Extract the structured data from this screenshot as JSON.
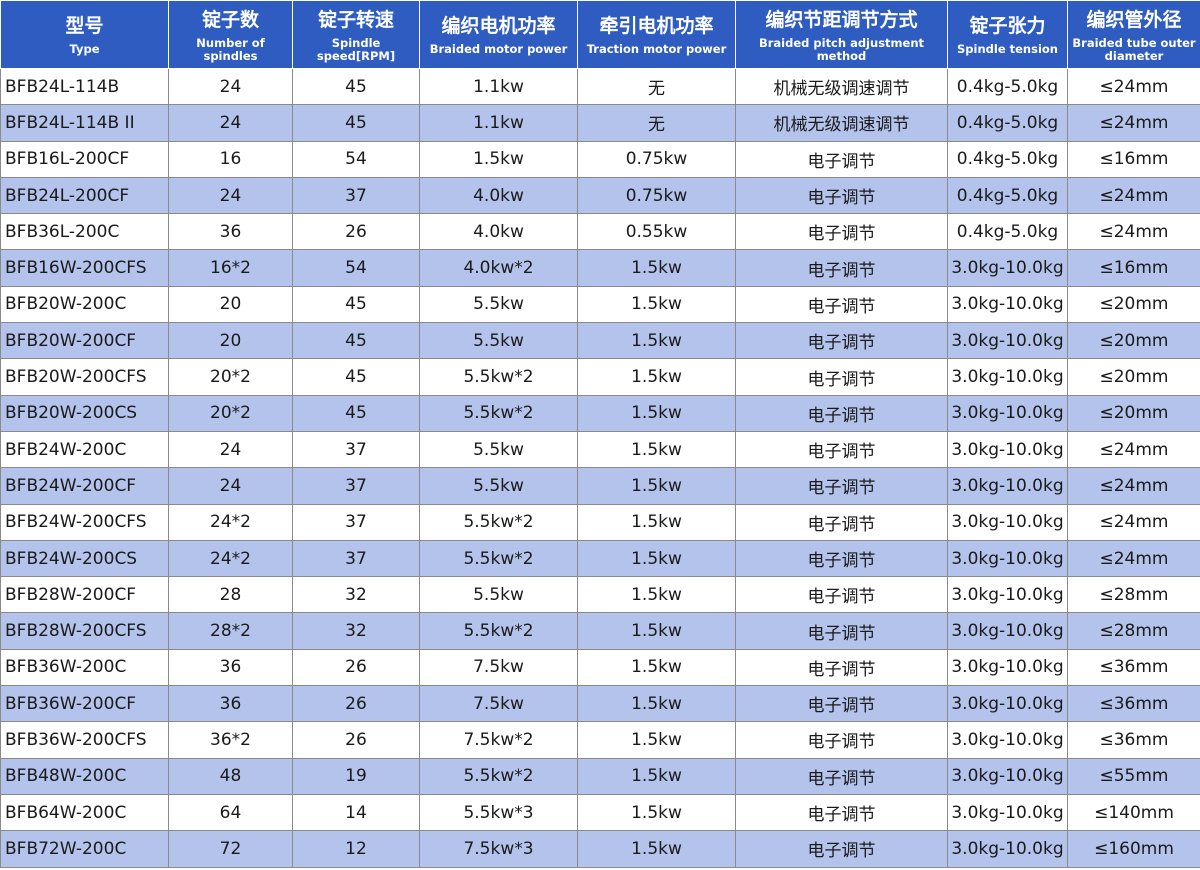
{
  "table": {
    "headers": [
      {
        "zh": "型号",
        "en": "Type"
      },
      {
        "zh": "锭子数",
        "en": "Number of spindles"
      },
      {
        "zh": "锭子转速",
        "en": "Spindle speed[RPM]"
      },
      {
        "zh": "编织电机功率",
        "en": "Braided motor power"
      },
      {
        "zh": "牵引电机功率",
        "en": "Traction motor power"
      },
      {
        "zh": "编织节距调节方式",
        "en": "Braided pitch adjustment method"
      },
      {
        "zh": "锭子张力",
        "en": "Spindle tension"
      },
      {
        "zh": "编织管外径",
        "en": "Braided tube outer diameter"
      }
    ],
    "rows": [
      [
        "BFB24L-114B",
        "24",
        "45",
        "1.1kw",
        "无",
        "机械无级调速调节",
        "0.4kg-5.0kg",
        "≤24mm"
      ],
      [
        "BFB24L-114B II",
        "24",
        "45",
        "1.1kw",
        "无",
        "机械无级调速调节",
        "0.4kg-5.0kg",
        "≤24mm"
      ],
      [
        "BFB16L-200CF",
        "16",
        "54",
        "1.5kw",
        "0.75kw",
        "电子调节",
        "0.4kg-5.0kg",
        "≤16mm"
      ],
      [
        "BFB24L-200CF",
        "24",
        "37",
        "4.0kw",
        "0.75kw",
        "电子调节",
        "0.4kg-5.0kg",
        "≤24mm"
      ],
      [
        "BFB36L-200C",
        "36",
        "26",
        "4.0kw",
        "0.55kw",
        "电子调节",
        "0.4kg-5.0kg",
        "≤24mm"
      ],
      [
        "BFB16W-200CFS",
        "16*2",
        "54",
        "4.0kw*2",
        "1.5kw",
        "电子调节",
        "3.0kg-10.0kg",
        "≤16mm"
      ],
      [
        "BFB20W-200C",
        "20",
        "45",
        "5.5kw",
        "1.5kw",
        "电子调节",
        "3.0kg-10.0kg",
        "≤20mm"
      ],
      [
        "BFB20W-200CF",
        "20",
        "45",
        "5.5kw",
        "1.5kw",
        "电子调节",
        "3.0kg-10.0kg",
        "≤20mm"
      ],
      [
        "BFB20W-200CFS",
        "20*2",
        "45",
        "5.5kw*2",
        "1.5kw",
        "电子调节",
        "3.0kg-10.0kg",
        "≤20mm"
      ],
      [
        "BFB20W-200CS",
        "20*2",
        "45",
        "5.5kw*2",
        "1.5kw",
        "电子调节",
        "3.0kg-10.0kg",
        "≤20mm"
      ],
      [
        "BFB24W-200C",
        "24",
        "37",
        "5.5kw",
        "1.5kw",
        "电子调节",
        "3.0kg-10.0kg",
        "≤24mm"
      ],
      [
        "BFB24W-200CF",
        "24",
        "37",
        "5.5kw",
        "1.5kw",
        "电子调节",
        "3.0kg-10.0kg",
        "≤24mm"
      ],
      [
        "BFB24W-200CFS",
        "24*2",
        "37",
        "5.5kw*2",
        "1.5kw",
        "电子调节",
        "3.0kg-10.0kg",
        "≤24mm"
      ],
      [
        "BFB24W-200CS",
        "24*2",
        "37",
        "5.5kw*2",
        "1.5kw",
        "电子调节",
        "3.0kg-10.0kg",
        "≤24mm"
      ],
      [
        "BFB28W-200CF",
        "28",
        "32",
        "5.5kw",
        "1.5kw",
        "电子调节",
        "3.0kg-10.0kg",
        "≤28mm"
      ],
      [
        "BFB28W-200CFS",
        "28*2",
        "32",
        "5.5kw*2",
        "1.5kw",
        "电子调节",
        "3.0kg-10.0kg",
        "≤28mm"
      ],
      [
        "BFB36W-200C",
        "36",
        "26",
        "7.5kw",
        "1.5kw",
        "电子调节",
        "3.0kg-10.0kg",
        "≤36mm"
      ],
      [
        "BFB36W-200CF",
        "36",
        "26",
        "7.5kw",
        "1.5kw",
        "电子调节",
        "3.0kg-10.0kg",
        "≤36mm"
      ],
      [
        "BFB36W-200CFS",
        "36*2",
        "26",
        "7.5kw*2",
        "1.5kw",
        "电子调节",
        "3.0kg-10.0kg",
        "≤36mm"
      ],
      [
        "BFB48W-200C",
        "48",
        "19",
        "5.5kw*2",
        "1.5kw",
        "电子调节",
        "3.0kg-10.0kg",
        "≤55mm"
      ],
      [
        "BFB64W-200C",
        "64",
        "14",
        "5.5kw*3",
        "1.5kw",
        "电子调节",
        "3.0kg-10.0kg",
        "≤140mm"
      ],
      [
        "BFB72W-200C",
        "72",
        "12",
        "7.5kw*3",
        "1.5kw",
        "电子调节",
        "3.0kg-10.0kg",
        "≤160mm"
      ]
    ]
  },
  "colors": {
    "header_bg": "#2f5cc0",
    "header_text": "#ffffff",
    "row_stripe": "#b4c3ec",
    "row_plain": "#ffffff",
    "grid": "#8a8a8a"
  }
}
